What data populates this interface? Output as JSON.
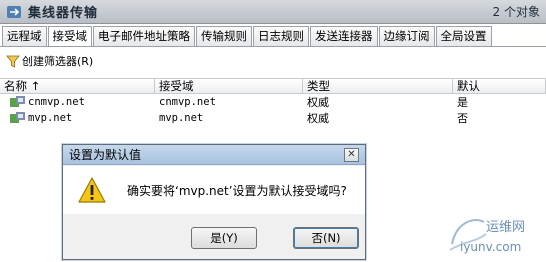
{
  "header": {
    "title": "集线器传输",
    "count": "2 个对象"
  },
  "tabs": [
    {
      "label": "远程域"
    },
    {
      "label": "接受域",
      "active": true
    },
    {
      "label": "电子邮件地址策略"
    },
    {
      "label": "传输规则"
    },
    {
      "label": "日志规则"
    },
    {
      "label": "发送连接器"
    },
    {
      "label": "边缘订阅"
    },
    {
      "label": "全局设置"
    }
  ],
  "toolbar": {
    "filter_label": "创建筛选器(R)"
  },
  "list": {
    "columns": [
      "名称 ↑",
      "接受域",
      "类型",
      "默认"
    ],
    "rows": [
      {
        "name": "cnmvp.net",
        "domain": "cnmvp.net",
        "type": "权威",
        "default": "是"
      },
      {
        "name": "mvp.net",
        "domain": "mvp.net",
        "type": "权威",
        "default": "否"
      }
    ]
  },
  "dialog": {
    "title": "设置为默认值",
    "message": "确实要将‘mvp.net’设置为默认接受域吗?",
    "yes_label": "是(Y)",
    "no_label": "否(N)"
  },
  "watermark": {
    "line1": "运维网",
    "line2": "iyunv.com"
  }
}
